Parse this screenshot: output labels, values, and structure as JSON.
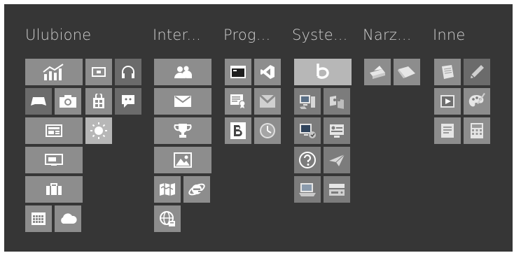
{
  "groups": [
    {
      "id": "ulubione",
      "title": "Ulubione"
    },
    {
      "id": "internet",
      "title": "Inter..."
    },
    {
      "id": "programy",
      "title": "Prog..."
    },
    {
      "id": "system",
      "title": "Syste..."
    },
    {
      "id": "narzedzia",
      "title": "Narz..."
    },
    {
      "id": "inne",
      "title": "Inne"
    }
  ],
  "colors": {
    "background": "#363636",
    "tile": "#8d8d8d",
    "tile_dark": "#6b6b6b",
    "tile_light": "#b7b7b7",
    "icon": "#ffffff",
    "title": "#cfcfcf"
  },
  "tiles": {
    "ulubione": [
      "finance-chart-icon",
      "camera-small-icon",
      "headphones-icon",
      "game-controller-icon",
      "camera-icon",
      "store-bag-icon",
      "feedback-icon",
      "news-icon",
      "weather-sun-icon",
      "presentation-icon",
      "briefcase-icon",
      "calendar-icon",
      "cloud-icon"
    ],
    "internet": [
      "people-icon",
      "mail-icon",
      "trophy-icon",
      "photos-icon",
      "maps-icon",
      "internet-explorer-icon",
      "network-globe-icon"
    ],
    "programy": [
      "console-icon",
      "visual-studio-icon",
      "certificate-icon",
      "gmail-icon",
      "b-logo-icon",
      "clock-disc-icon"
    ],
    "system": [
      "bing-logo-icon",
      "computer-icon",
      "desktop-icon",
      "pc-settings-icon",
      "control-panel-icon",
      "help-icon",
      "send-paper-plane-icon",
      "system-image-icon",
      "drive-icon"
    ],
    "narzedzia": [
      "scanner-icon",
      "paper-icon"
    ],
    "inne": [
      "notepad-icon",
      "pen-icon",
      "media-player-icon",
      "paint-icon",
      "document-icon",
      "calculator-icon"
    ]
  }
}
